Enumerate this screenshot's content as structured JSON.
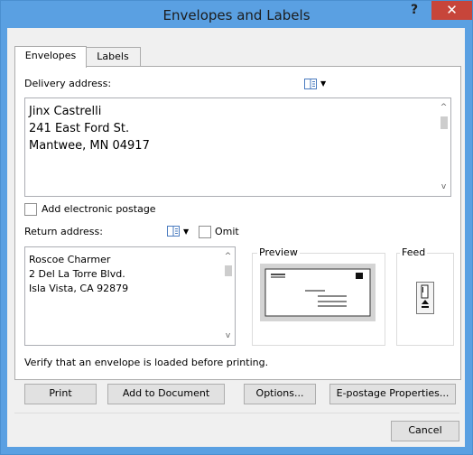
{
  "window": {
    "title": "Envelopes and Labels",
    "help_glyph": "?",
    "close_glyph": "✕"
  },
  "tabs": [
    {
      "label": "Envelopes"
    },
    {
      "label": "Labels"
    }
  ],
  "delivery": {
    "label": "Delivery address:",
    "lines": [
      "Jinx Castrelli",
      "241 East Ford St.",
      "Mantwee, MN 04917"
    ]
  },
  "postage": {
    "label": "Add electronic postage",
    "checked": false
  },
  "return_address": {
    "label": "Return address:",
    "omit_label": "Omit",
    "omit_checked": false,
    "lines": [
      "Roscoe Charmer",
      "2 Del La Torre Blvd.",
      "Isla Vista, CA 92879"
    ]
  },
  "preview": {
    "label": "Preview"
  },
  "feed": {
    "label": "Feed"
  },
  "verify_text": "Verify that an envelope is loaded before printing.",
  "buttons": {
    "print": "Print",
    "add_to_document": "Add to Document",
    "options": "Options...",
    "epostage": "E-postage Properties...",
    "cancel": "Cancel"
  },
  "icons": {
    "address_book": "address-book-icon",
    "dropdown": "chevron-down-icon",
    "scroll_up": "scroll-up-arrow-icon",
    "scroll_down": "scroll-down-arrow-icon"
  },
  "colors": {
    "titlebar": "#5aa0e2",
    "close_button": "#c7453a",
    "dialog_bg": "#f0f0f0"
  }
}
